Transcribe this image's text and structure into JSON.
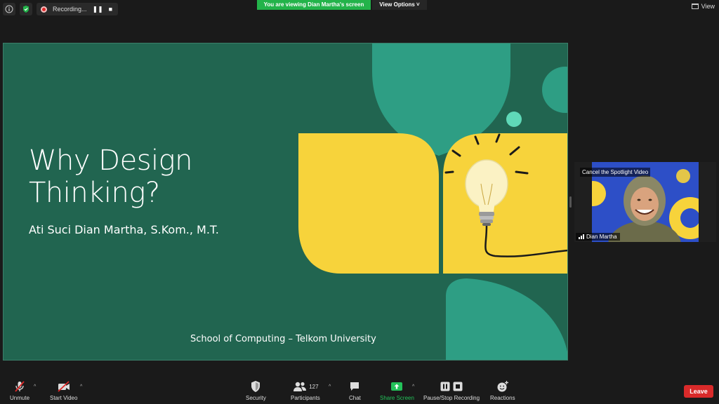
{
  "top_bar": {
    "recording_label": "Recording...",
    "viewing_banner": "You are viewing Dian Martha's screen",
    "view_options_label": "View Options ˅",
    "view_label": "View"
  },
  "slide": {
    "title_line1": "Why Design",
    "title_line2": "Thinking?",
    "author": "Ati Suci Dian Martha, S.Kom., M.T.",
    "footer": "School of Computing – Telkom University",
    "colors": {
      "background": "#216550",
      "yellow": "#f7d33b",
      "teal": "#2e9e84",
      "light_teal": "#5fd9b8"
    }
  },
  "spotlight": {
    "cancel_label": "Cancel the Spotlight Video",
    "participant_name": "Dian Martha"
  },
  "toolbar": {
    "unmute_label": "Unmute",
    "start_video_label": "Start Video",
    "security_label": "Security",
    "participants_label": "Participants",
    "participants_count": "127",
    "chat_label": "Chat",
    "share_screen_label": "Share Screen",
    "pause_stop_recording_label": "Pause/Stop Recording",
    "reactions_label": "Reactions",
    "leave_label": "Leave"
  }
}
